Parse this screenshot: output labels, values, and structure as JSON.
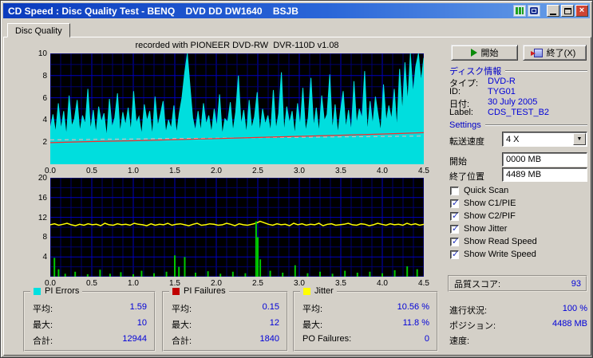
{
  "window": {
    "title": "CD Speed : Disc Quality Test - BENQ    DVD DD DW1640    BSJB",
    "tab": "Disc Quality"
  },
  "chart_header": "recorded with PIONEER DVD-RW  DVR-110D v1.08",
  "buttons": {
    "start": "開始",
    "exit": "終了(X)"
  },
  "disc_info": {
    "header": "ディスク情報",
    "rows": [
      {
        "label": "タイプ:",
        "value": "DVD-R"
      },
      {
        "label": "ID:",
        "value": "TYG01"
      },
      {
        "label": "日付:",
        "value": "30 July 2005"
      },
      {
        "label": "Label:",
        "value": "CDS_TEST_B2"
      }
    ]
  },
  "settings": {
    "header": "Settings",
    "speed_label": "転送速度",
    "speed_value": "4 X",
    "start_label": "開始",
    "start_value": "0000 MB",
    "end_label": "終了位置",
    "end_value": "4489 MB",
    "checkboxes": [
      {
        "label": "Quick Scan",
        "checked": false
      },
      {
        "label": "Show C1/PIE",
        "checked": true
      },
      {
        "label": "Show C2/PIF",
        "checked": true
      },
      {
        "label": "Show Jitter",
        "checked": true
      },
      {
        "label": "Show Read Speed",
        "checked": true
      },
      {
        "label": "Show Write Speed",
        "checked": true
      }
    ]
  },
  "quality": {
    "label": "品質スコア:",
    "value": "93"
  },
  "progress": [
    {
      "label": "進行状況:",
      "value": "100 %"
    },
    {
      "label": "ポジション:",
      "value": "4488 MB"
    },
    {
      "label": "速度:",
      "value": ""
    }
  ],
  "stats": [
    {
      "title": "PI Errors",
      "color": "#00e0e0",
      "rows": [
        {
          "label": "平均:",
          "value": "1.59"
        },
        {
          "label": "最大:",
          "value": "10"
        },
        {
          "label": "合計:",
          "value": "12944"
        }
      ]
    },
    {
      "title": "PI Failures",
      "color": "#c00000",
      "rows": [
        {
          "label": "平均:",
          "value": "0.15"
        },
        {
          "label": "最大:",
          "value": "12"
        },
        {
          "label": "合計:",
          "value": "1840"
        }
      ]
    },
    {
      "title": "Jitter",
      "color": "#ffff00",
      "rows": [
        {
          "label": "平均:",
          "value": "10.56 %"
        },
        {
          "label": "最大:",
          "value": "11.8 %"
        },
        {
          "label": "PO Failures:",
          "value": "0"
        }
      ]
    }
  ],
  "chart_data": [
    {
      "type": "area",
      "title": "PI Errors vs position (GB)",
      "xlim": [
        0,
        4.5
      ],
      "ylim": [
        0,
        10
      ],
      "yticks": [
        2,
        4,
        6,
        8,
        10
      ],
      "xticks": [
        "0.0",
        "0.5",
        "1.0",
        "1.5",
        "2.0",
        "2.5",
        "3.0",
        "3.5",
        "4.0",
        "4.5"
      ],
      "grid": {
        "dx": 0.125,
        "dx_major": 0.5,
        "dy": 1,
        "dy_major": 2,
        "color": "#00006e",
        "major": "#0000c0"
      },
      "series": [
        {
          "name": "PI Errors",
          "style": "area",
          "color": "#00dede",
          "values": [
            3.2,
            4.5,
            2.8,
            5.5,
            3.1,
            4.8,
            2.5,
            6.2,
            3.4,
            4.1,
            5.8,
            2.9,
            4.4,
            3.6,
            6.8,
            3.0,
            4.9,
            2.7,
            5.2,
            3.8,
            4.6,
            2.4,
            5.9,
            3.3,
            4.2,
            6.4,
            2.8,
            4.7,
            3.5,
            5.1,
            2.9,
            6.6,
            3.7,
            4.3,
            2.6,
            5.4,
            3.9,
            4.8,
            2.5,
            6.1,
            3.4,
            4.5,
            5.7,
            2.8,
            4.0,
            3.2,
            5.3,
            2.7,
            4.6,
            6.0,
            8.2,
            10.0,
            7.0,
            4.2,
            3.0,
            4.8,
            2.9,
            5.5,
            3.6,
            4.4,
            2.8,
            5.0,
            3.3,
            6.3,
            2.6,
            4.1,
            3.8,
            5.6,
            2.9,
            4.7,
            8.0,
            3.5,
            4.9,
            2.7,
            5.8,
            3.2,
            4.3,
            6.5,
            2.8,
            5.0,
            3.6,
            4.4,
            2.9,
            6.7,
            3.1,
            4.6,
            8.3,
            2.8,
            5.2,
            3.7,
            4.8,
            2.6,
            5.5,
            3.4,
            6.9,
            2.9,
            4.2,
            7.8,
            3.3,
            5.1,
            2.8,
            6.2,
            3.9,
            4.5,
            8.1,
            3.0,
            5.4,
            2.7,
            4.8,
            6.6,
            3.2,
            4.9,
            2.9,
            7.5,
            3.6,
            5.0,
            4.1,
            8.4,
            2.8,
            5.7,
            3.5,
            6.1,
            4.4,
            2.9,
            7.2,
            3.8,
            5.3,
            4.0,
            6.8,
            3.1,
            8.6,
            4.6,
            9.2,
            5.5,
            10.0,
            6.3,
            8.8,
            10.0,
            7.4,
            9.6
          ]
        },
        {
          "name": "Write Speed",
          "style": "dashed-line",
          "color": "#ffb4b4",
          "width": 1,
          "points": [
            [
              0,
              2.2
            ],
            [
              4.5,
              2.55
            ]
          ]
        },
        {
          "name": "Read Speed",
          "style": "line",
          "color": "#ff2a2a",
          "width": 1.2,
          "points": [
            [
              0,
              1.95
            ],
            [
              0.5,
              2.05
            ],
            [
              1.0,
              2.12
            ],
            [
              1.5,
              2.22
            ],
            [
              2.0,
              2.32
            ],
            [
              2.5,
              2.42
            ],
            [
              3.0,
              2.52
            ],
            [
              3.5,
              2.62
            ],
            [
              4.0,
              2.73
            ],
            [
              4.5,
              2.85
            ]
          ]
        }
      ]
    },
    {
      "type": "line",
      "title": "PI Failures and Jitter vs position (GB)",
      "xlim": [
        0,
        4.5
      ],
      "ylim": [
        0,
        20
      ],
      "yticks": [
        4,
        8,
        12,
        16,
        20
      ],
      "xticks": [
        "0.0",
        "0.5",
        "1.0",
        "1.5",
        "2.0",
        "2.5",
        "3.0",
        "3.5",
        "4.0",
        "4.5"
      ],
      "grid": {
        "dx": 0.125,
        "dx_major": 0.5,
        "dy": 2,
        "dy_major": 4,
        "color": "#00006e",
        "major": "#0000c0"
      },
      "series": [
        {
          "name": "Jitter",
          "style": "line",
          "color": "#ffff00",
          "width": 1.5,
          "values": [
            10.5,
            10.7,
            10.4,
            10.6,
            10.8,
            10.5,
            10.3,
            10.6,
            10.4,
            10.7,
            10.5,
            10.6,
            10.3,
            10.8,
            10.5,
            10.4,
            10.7,
            10.5,
            10.6,
            10.4,
            10.8,
            10.6,
            10.5,
            10.3,
            10.7,
            10.4,
            10.6,
            10.5,
            10.8,
            10.4,
            10.6,
            10.7,
            10.5,
            10.3,
            10.6,
            10.8,
            10.4,
            10.5,
            10.7,
            10.6,
            10.4,
            10.5,
            10.8,
            10.6,
            10.3,
            10.7,
            10.5,
            10.4,
            10.6,
            10.8,
            11.2,
            10.9,
            10.6,
            10.4,
            10.7,
            10.5,
            10.6,
            10.3,
            10.8,
            10.5,
            10.7,
            10.4,
            10.6,
            10.5,
            10.8,
            10.3,
            10.6,
            10.7,
            10.4,
            10.5,
            10.6,
            10.8,
            10.5,
            10.4,
            10.7,
            10.6,
            10.3,
            10.5,
            10.8,
            10.6,
            10.4,
            10.7,
            10.5,
            10.6,
            10.4,
            10.8,
            10.5,
            10.7,
            10.4,
            10.6
          ]
        },
        {
          "name": "PI Failures",
          "style": "spikes",
          "color": "#00c800",
          "points": [
            [
              0.05,
              3.8
            ],
            [
              0.1,
              1.5
            ],
            [
              0.18,
              0.6
            ],
            [
              0.3,
              1.0
            ],
            [
              0.45,
              0.5
            ],
            [
              0.6,
              1.4
            ],
            [
              0.72,
              0.6
            ],
            [
              0.85,
              0.9
            ],
            [
              1.0,
              0.5
            ],
            [
              1.1,
              1.2
            ],
            [
              1.25,
              0.7
            ],
            [
              1.4,
              1.0
            ],
            [
              1.5,
              4.3
            ],
            [
              1.55,
              2.0
            ],
            [
              1.62,
              4.0
            ],
            [
              1.75,
              0.8
            ],
            [
              1.9,
              1.1
            ],
            [
              2.05,
              0.6
            ],
            [
              2.2,
              1.0
            ],
            [
              2.35,
              0.7
            ],
            [
              2.48,
              11.2
            ],
            [
              2.5,
              8.0
            ],
            [
              2.53,
              3.5
            ],
            [
              2.65,
              1.2
            ],
            [
              2.8,
              0.8
            ],
            [
              2.95,
              2.3
            ],
            [
              3.1,
              0.7
            ],
            [
              3.25,
              1.0
            ],
            [
              3.4,
              0.6
            ],
            [
              3.55,
              1.2
            ],
            [
              3.7,
              0.8
            ],
            [
              3.85,
              1.0
            ],
            [
              4.0,
              0.7
            ],
            [
              4.15,
              1.3
            ],
            [
              4.3,
              2.1
            ],
            [
              4.42,
              1.5
            ]
          ]
        }
      ]
    }
  ]
}
